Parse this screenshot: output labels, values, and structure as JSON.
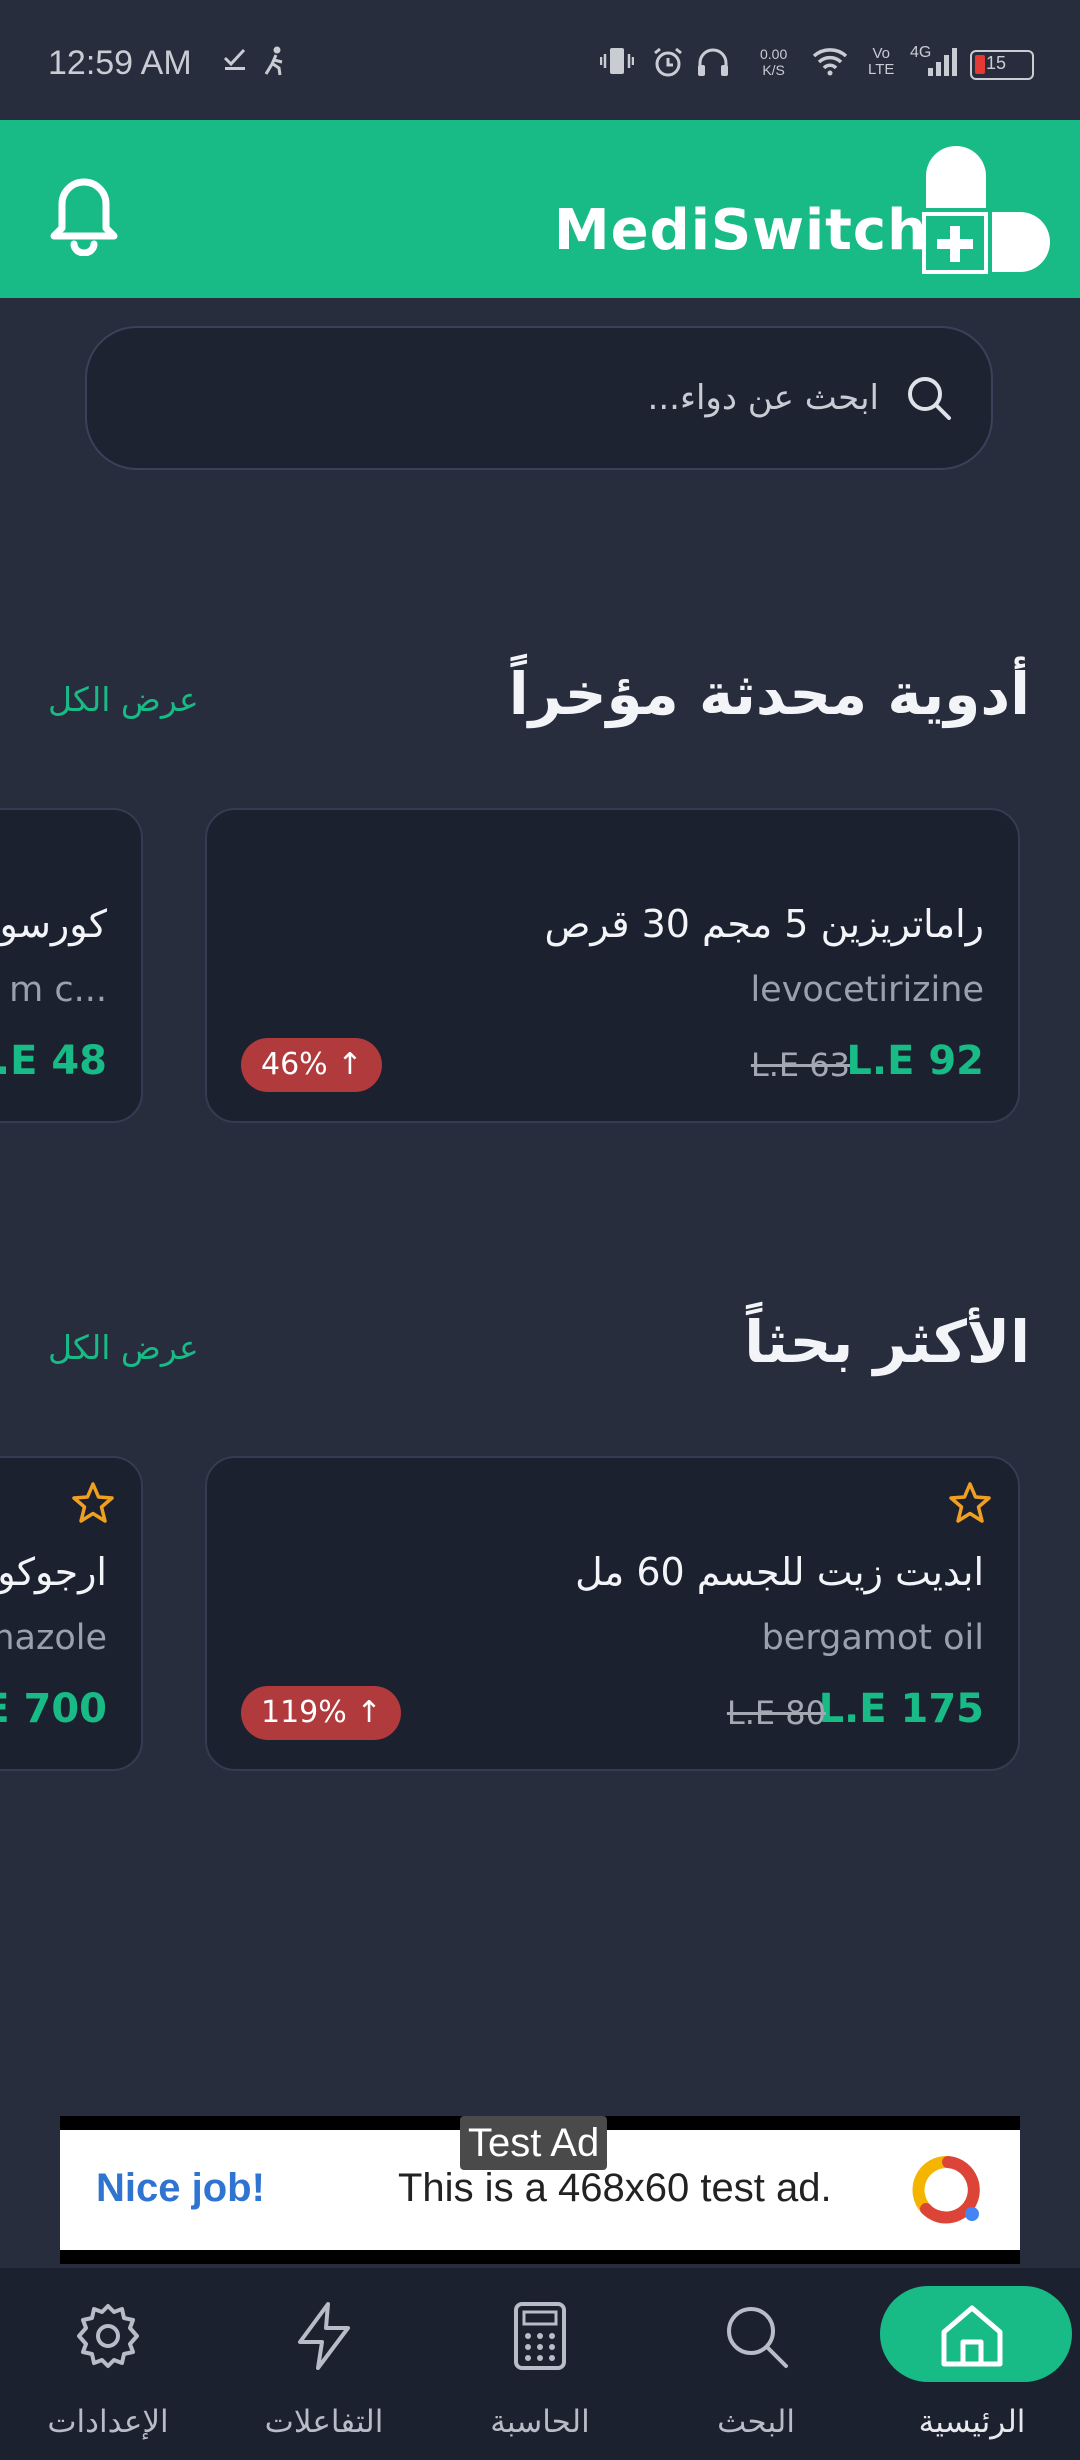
{
  "status_bar": {
    "time": "12:59 AM",
    "network_speed_top": "0.00",
    "network_speed_bottom": "K/S",
    "volte_top": "Vo",
    "volte_bottom": "LTE",
    "network_type": "4G",
    "battery_level": "15"
  },
  "header": {
    "brand_name": "MediSwitch",
    "notification_icon": "bell-icon",
    "logo_icon": "pill-plus-logo"
  },
  "search": {
    "placeholder": "ابحث عن دواء..."
  },
  "sections": {
    "recent": {
      "title": "أدوية محدثة مؤخراً",
      "view_all": "عرض الكل",
      "cards": [
        {
          "name": "راماتريزين 5 مجم 30 قرص",
          "generic": "levocetirizine",
          "price_new": "L.E 92",
          "price_old": "L.E 63",
          "change": "46%"
        },
        {
          "name": "كورسو",
          "generic": "m c...",
          "price_new": ".E 48"
        }
      ]
    },
    "popular": {
      "title": "الأكثر بحثاً",
      "view_all": "عرض الكل",
      "cards": [
        {
          "name": "ابديت زيت للجسم 60 مل",
          "generic": "bergamot oil",
          "price_new": "L.E 175",
          "price_old": "L.E 80",
          "change": "119%"
        },
        {
          "name": "ارجوكو",
          "generic": "nazole",
          "price_new": "E 700"
        }
      ]
    }
  },
  "ad": {
    "label": "Test Ad",
    "headline": "Nice job!",
    "text": "This is a 468x60 test ad."
  },
  "bottom_nav": {
    "items": [
      {
        "label": "الإعدادات",
        "icon": "gear-icon"
      },
      {
        "label": "التفاعلات",
        "icon": "lightning-icon"
      },
      {
        "label": "الحاسبة",
        "icon": "calculator-icon"
      },
      {
        "label": "البحث",
        "icon": "search-icon"
      },
      {
        "label": "الرئيسية",
        "icon": "home-icon",
        "active": true
      }
    ]
  },
  "colors": {
    "background": "#272d3c",
    "accent": "#18ba86",
    "card": "#1c2130",
    "badge_red": "#b13a3d",
    "star": "#f0a020"
  }
}
